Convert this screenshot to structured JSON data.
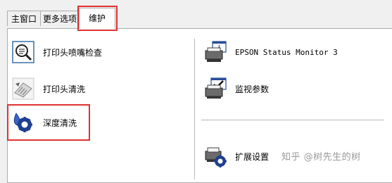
{
  "tabs": [
    {
      "label": "主窗口"
    },
    {
      "label": "更多选项"
    },
    {
      "label": "维护"
    }
  ],
  "left_buttons": {
    "nozzle_check": "打印头喷嘴检查",
    "head_cleaning": "打印头清洗",
    "deep_cleaning": "深度清洗"
  },
  "right_buttons": {
    "status_monitor": "EPSON Status Monitor 3",
    "monitor_params": "监视参数",
    "extended_settings": "扩展设置"
  },
  "watermark": "知乎 @树先生的树",
  "colors": {
    "highlight": "#e03232",
    "tab_active_bg": "#ffffff"
  }
}
